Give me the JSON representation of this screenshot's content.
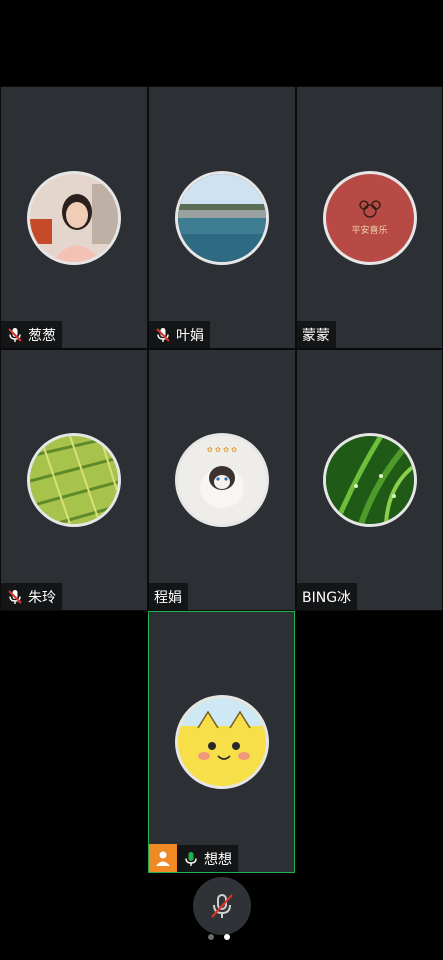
{
  "participants": [
    {
      "name": "葱葱",
      "mic": "muted"
    },
    {
      "name": "叶娟",
      "mic": "muted"
    },
    {
      "name": "蒙蒙",
      "mic": "none"
    },
    {
      "name": "朱玲",
      "mic": "muted"
    },
    {
      "name": "程娟",
      "mic": "none"
    },
    {
      "name": "BING冰",
      "mic": "none"
    },
    {
      "name": "想想",
      "mic": "active",
      "is_self": true
    }
  ],
  "avatar_texts": {
    "mengmeng": "平安喜乐"
  },
  "controls": {
    "mic_button": "microphone-muted-icon"
  },
  "pager": {
    "count": 2,
    "current": 2
  },
  "colors": {
    "tile_bg": "#2c2f33",
    "active_border": "#22b14c",
    "muted_red": "#d9362b",
    "mic_green": "#22b14c",
    "self_badge": "#f08a24"
  }
}
